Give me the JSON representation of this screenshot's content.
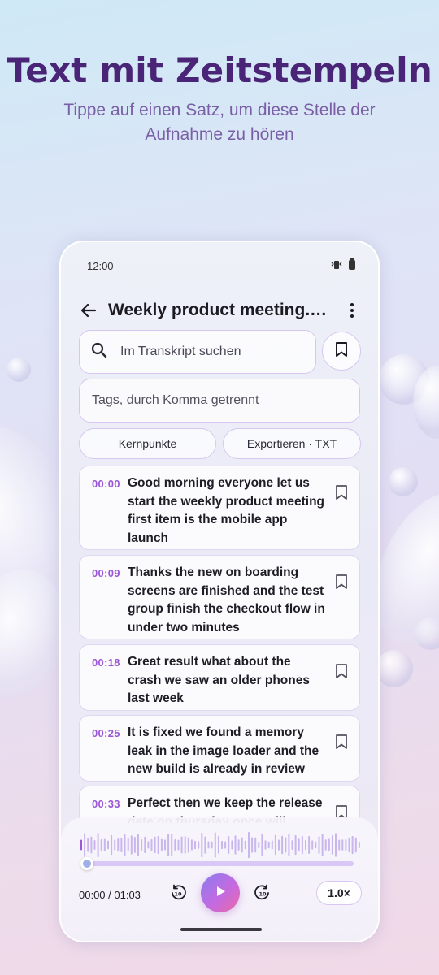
{
  "hero": {
    "title": "Text mit Zeitstempeln",
    "subtitle_line1": "Tippe auf einen Satz, um diese Stelle der",
    "subtitle_line2": "Aufnahme zu hören"
  },
  "status_bar": {
    "time": "12:00"
  },
  "app_bar": {
    "title": "Weekly product meeting.m..."
  },
  "search": {
    "placeholder": "Im Transkript suchen"
  },
  "tags": {
    "placeholder": "Tags, durch Komma getrennt"
  },
  "chips": {
    "key_points": "Kernpunkte",
    "export": "Exportieren · TXT"
  },
  "segments": [
    {
      "time": "00:00",
      "text": "Good morning everyone let us start the weekly product meeting first item is the mobile app launch"
    },
    {
      "time": "00:09",
      "text": "Thanks the new on boarding screens are finished and the test group finish the checkout flow in under two minutes"
    },
    {
      "time": "00:18",
      "text": "Great result what about the crash we saw an older phones last week"
    },
    {
      "time": "00:25",
      "text": "It is fixed we found a memory leak in the image loader and the new build is already in review"
    },
    {
      "time": "00:33",
      "text": "Perfect then we keep the release date on thursday once will"
    }
  ],
  "player": {
    "position": "00:00 / 01:03",
    "progress_fraction": 0.0,
    "speed": "1.0×",
    "skip_back_seconds": "10",
    "skip_forward_seconds": "10"
  },
  "colors": {
    "accent": "#9b57d8",
    "title": "#4a2476",
    "subtitle": "#7a5ea6",
    "play_gradient": [
      "#8a7df0",
      "#c46ae0",
      "#ea6aa6"
    ]
  }
}
